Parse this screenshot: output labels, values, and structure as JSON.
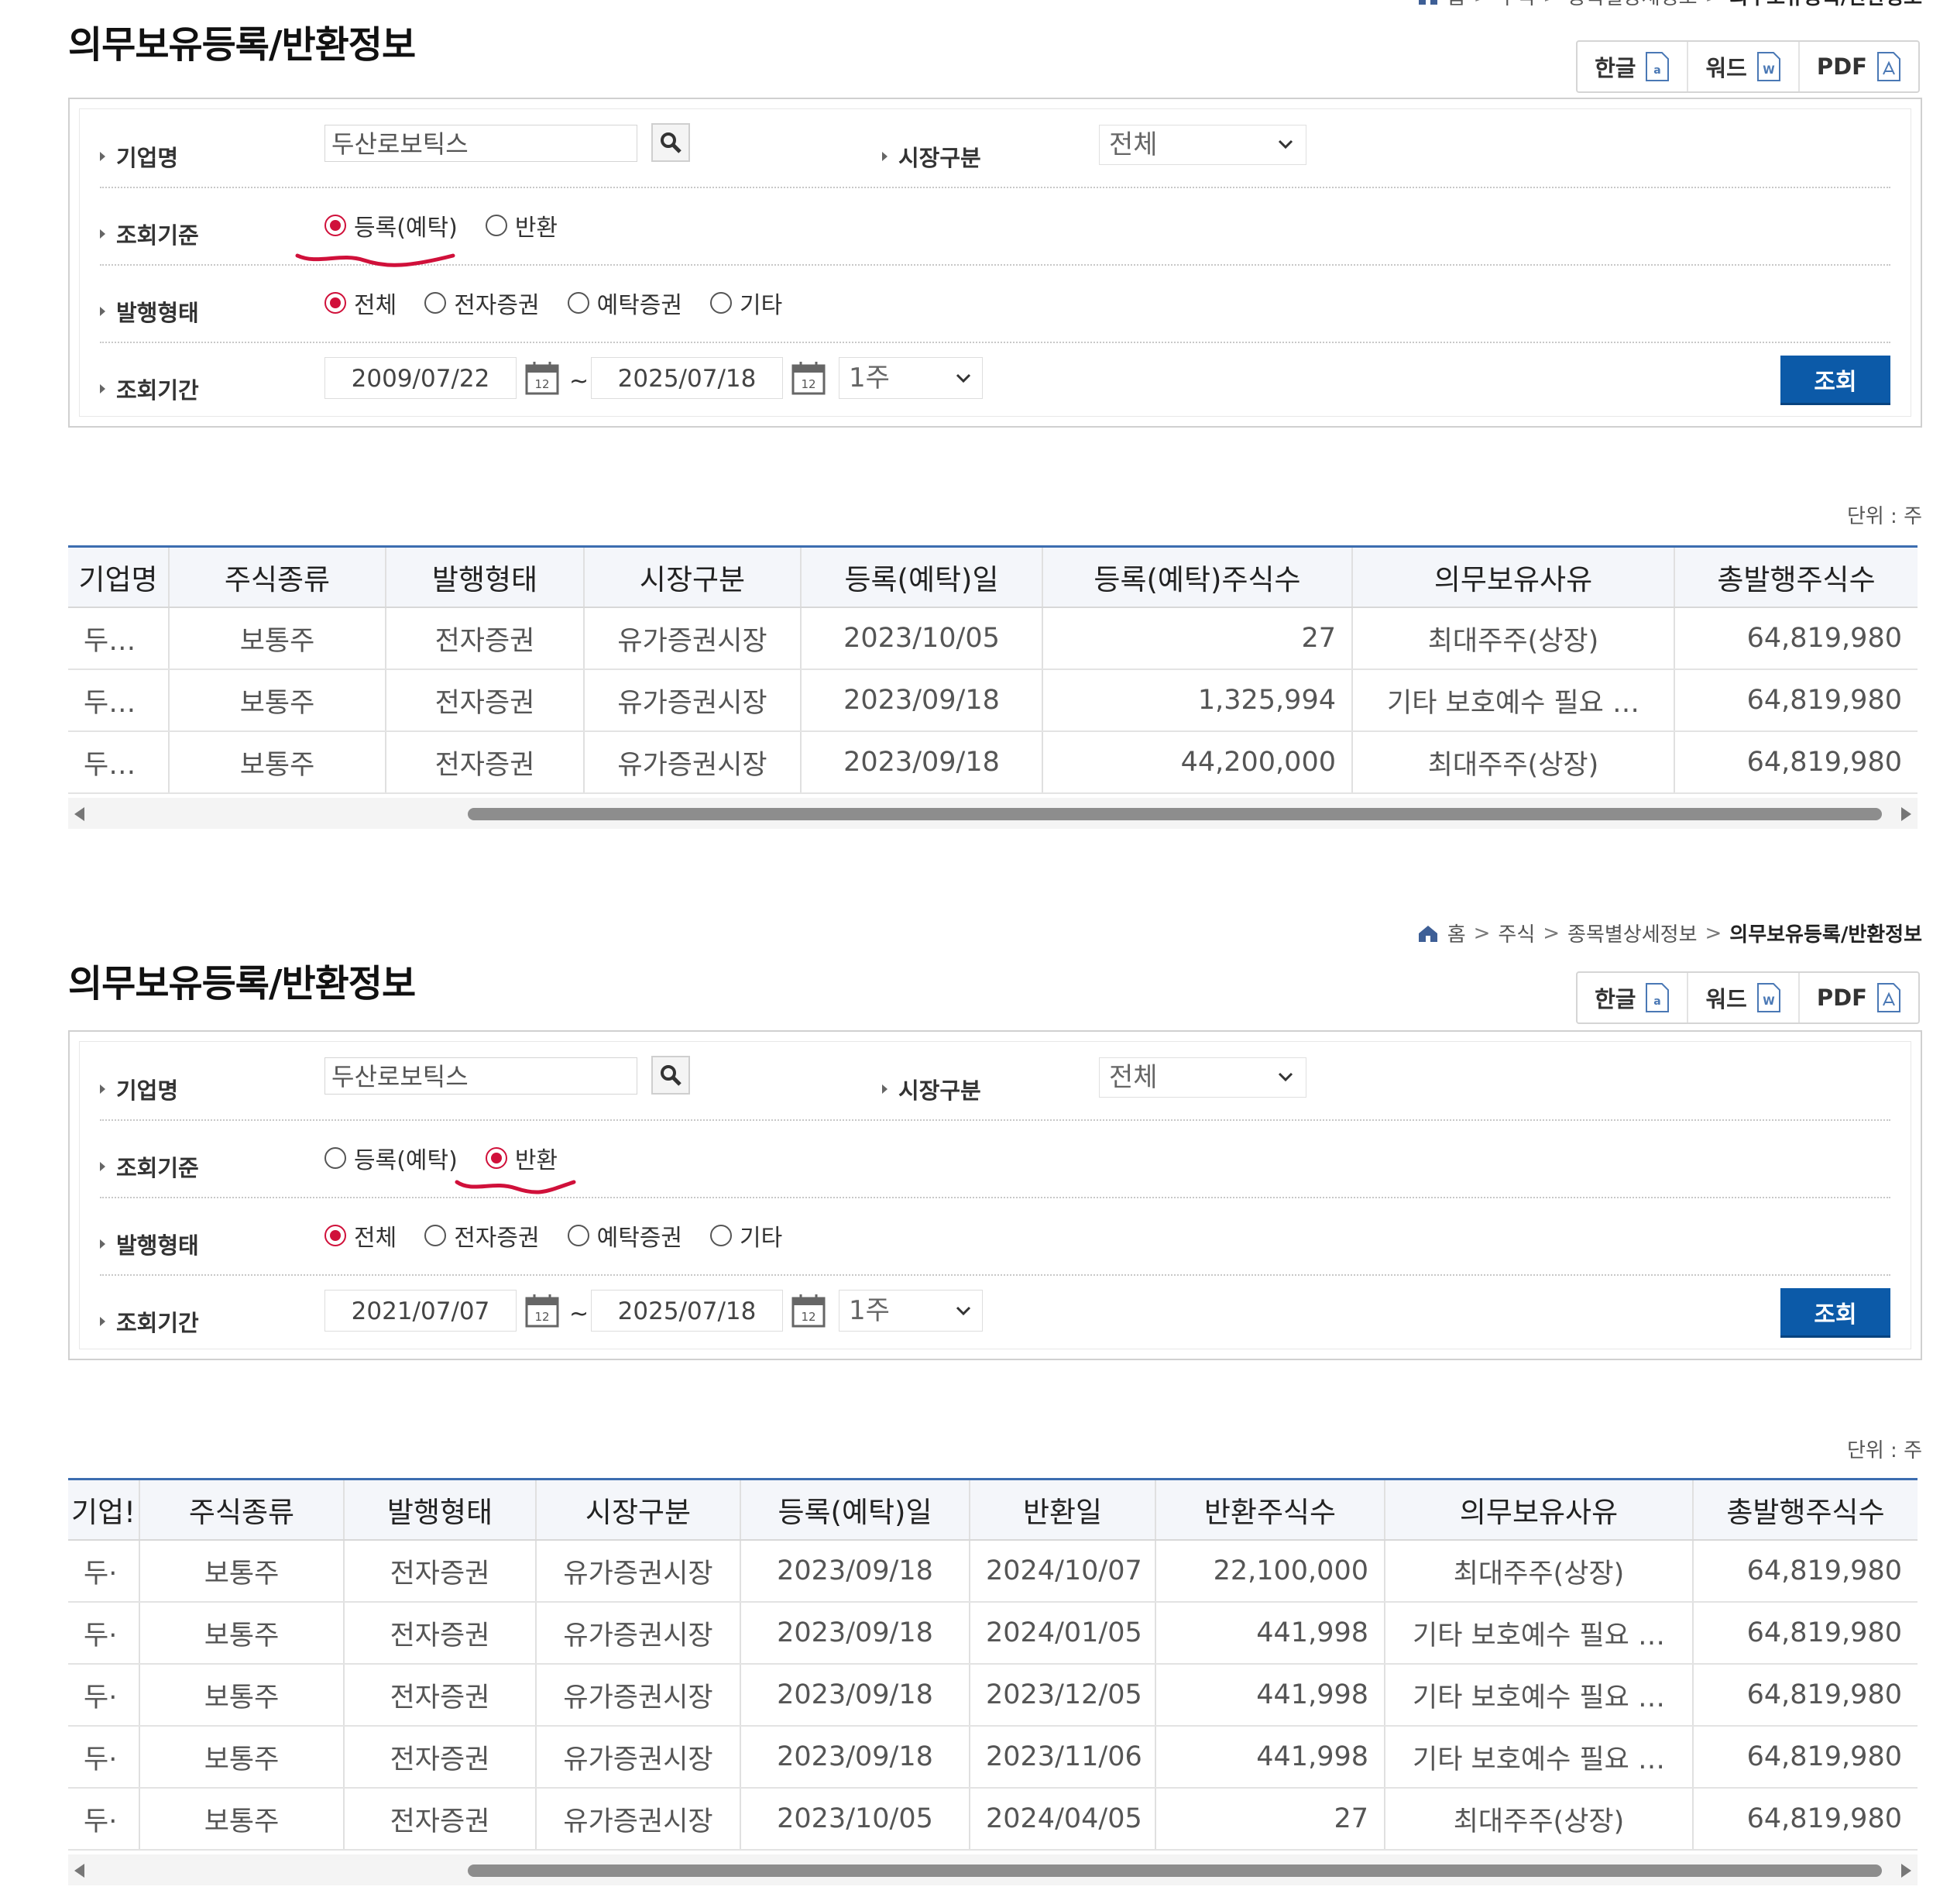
{
  "breadcrumb": {
    "home": "홈",
    "sep": ">",
    "level1": "주식",
    "level2": "종목별상세정보",
    "current": "의무보유등록/반환정보"
  },
  "page_title": "의무보유등록/반환정보",
  "doc_buttons": {
    "hwp": "한글",
    "word": "워드",
    "pdf": "PDF"
  },
  "search": {
    "company_label": "기업명",
    "market_label": "시장구분",
    "criteria_label": "조회기준",
    "issue_type_label": "발행형태",
    "period_label": "조회기간",
    "radio_register": "등록(예탁)",
    "radio_return": "반환",
    "radio_all": "전체",
    "radio_electronic": "전자증권",
    "radio_deposit": "예탁증권",
    "radio_other": "기타",
    "query_button": "조회",
    "tilde": "~"
  },
  "unit_label": "단위 : 주",
  "accent_color": "#d0103a",
  "query_button_color": "#0c5aa8",
  "panel1": {
    "company_value": "두산로보틱스",
    "market_value": "전체",
    "criteria_selected": "등록(예탁)",
    "issue_type_selected": "전체",
    "date_from": "2009/07/22",
    "date_to": "2025/07/18",
    "period": "1주",
    "headers": [
      "기업명",
      "주식종류",
      "발행형태",
      "시장구분",
      "등록(예탁)일",
      "등록(예탁)주식수",
      "의무보유사유",
      "총발행주식수"
    ],
    "rows": [
      [
        "두…",
        "보통주",
        "전자증권",
        "유가증권시장",
        "2023/10/05",
        "27",
        "최대주주(상장)",
        "64,819,980"
      ],
      [
        "두…",
        "보통주",
        "전자증권",
        "유가증권시장",
        "2023/09/18",
        "1,325,994",
        "기타 보호예수 필요 …",
        "64,819,980"
      ],
      [
        "두…",
        "보통주",
        "전자증권",
        "유가증권시장",
        "2023/09/18",
        "44,200,000",
        "최대주주(상장)",
        "64,819,980"
      ]
    ]
  },
  "panel2": {
    "company_value": "두산로보틱스",
    "market_value": "전체",
    "criteria_selected": "반환",
    "issue_type_selected": "전체",
    "date_from": "2021/07/07",
    "date_to": "2025/07/18",
    "period": "1주",
    "headers": [
      "기업!",
      "주식종류",
      "발행형태",
      "시장구분",
      "등록(예탁)일",
      "반환일",
      "반환주식수",
      "의무보유사유",
      "총발행주식수"
    ],
    "rows": [
      [
        "두·",
        "보통주",
        "전자증권",
        "유가증권시장",
        "2023/09/18",
        "2024/10/07",
        "22,100,000",
        "최대주주(상장)",
        "64,819,980"
      ],
      [
        "두·",
        "보통주",
        "전자증권",
        "유가증권시장",
        "2023/09/18",
        "2024/01/05",
        "441,998",
        "기타 보호예수 필요 …",
        "64,819,980"
      ],
      [
        "두·",
        "보통주",
        "전자증권",
        "유가증권시장",
        "2023/09/18",
        "2023/12/05",
        "441,998",
        "기타 보호예수 필요 …",
        "64,819,980"
      ],
      [
        "두·",
        "보통주",
        "전자증권",
        "유가증권시장",
        "2023/09/18",
        "2023/11/06",
        "441,998",
        "기타 보호예수 필요 …",
        "64,819,980"
      ],
      [
        "두·",
        "보통주",
        "전자증권",
        "유가증권시장",
        "2023/10/05",
        "2024/04/05",
        "27",
        "최대주주(상장)",
        "64,819,980"
      ]
    ]
  }
}
